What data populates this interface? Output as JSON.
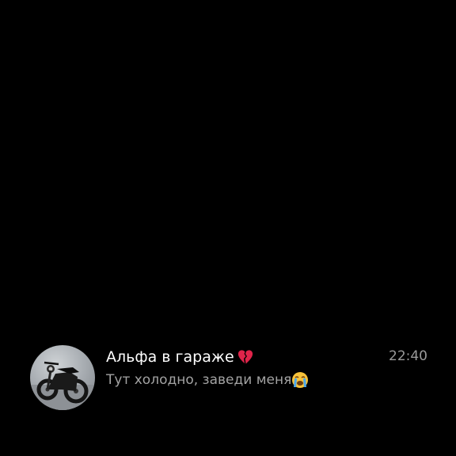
{
  "chat": {
    "title": "Альфа в гараже",
    "title_emoji": "broken-heart-icon",
    "time": "22:40",
    "preview": "Тут холодно, заведи меня",
    "preview_emoji": "loudly-crying-face-icon",
    "avatar": "motorcycle-photo"
  },
  "colors": {
    "background": "#000000",
    "title": "#ffffff",
    "secondary_text": "#a3a3a3",
    "heart": "#e0244a",
    "emoji_face": "#f7c23a"
  }
}
